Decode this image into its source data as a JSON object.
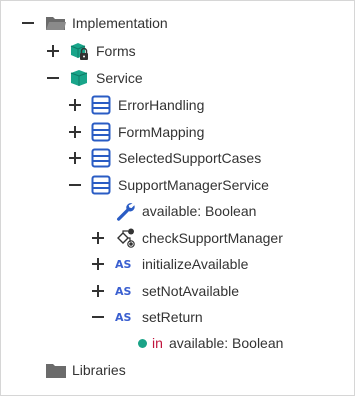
{
  "tree": {
    "root": {
      "label": "Implementation",
      "expanded": true,
      "icon": "folder-open-icon"
    },
    "forms": {
      "label": "Forms",
      "expanded": false,
      "icon": "locked-package-icon"
    },
    "service": {
      "label": "Service",
      "expanded": true,
      "icon": "package-icon"
    },
    "error_handling": {
      "label": "ErrorHandling",
      "expanded": false,
      "icon": "window-icon"
    },
    "form_mapping": {
      "label": "FormMapping",
      "expanded": false,
      "icon": "window-icon"
    },
    "selected_support_cases": {
      "label": "SelectedSupportCases",
      "expanded": false,
      "icon": "window-icon"
    },
    "support_manager_service": {
      "label": "SupportManagerService",
      "expanded": true,
      "icon": "window-icon"
    },
    "available": {
      "label": "available: Boolean",
      "icon": "wrench-icon"
    },
    "check_support_manager": {
      "label": "checkSupportManager",
      "expanded": false,
      "icon": "flow-icon"
    },
    "initialize_available": {
      "label": "initializeAvailable",
      "expanded": false,
      "icon": "as-icon",
      "icon_text": "AS"
    },
    "set_not_available": {
      "label": "setNotAvailable",
      "expanded": false,
      "icon": "as-icon",
      "icon_text": "AS"
    },
    "set_return": {
      "label": "setReturn",
      "expanded": true,
      "icon": "as-icon",
      "icon_text": "AS"
    },
    "in_param": {
      "keyword": "in",
      "label": "available: Boolean",
      "icon": "bullet-icon"
    },
    "libraries": {
      "label": "Libraries",
      "icon": "folder-icon"
    }
  },
  "colors": {
    "text": "#333333",
    "toggle": "#333333",
    "folder": "#555555",
    "package": "#19a58a",
    "window": "#2a5cc4",
    "wrench": "#2a5cc4",
    "as": "#3a5fd0",
    "bullet": "#1aa387",
    "keyword_in": "#c0143c"
  }
}
